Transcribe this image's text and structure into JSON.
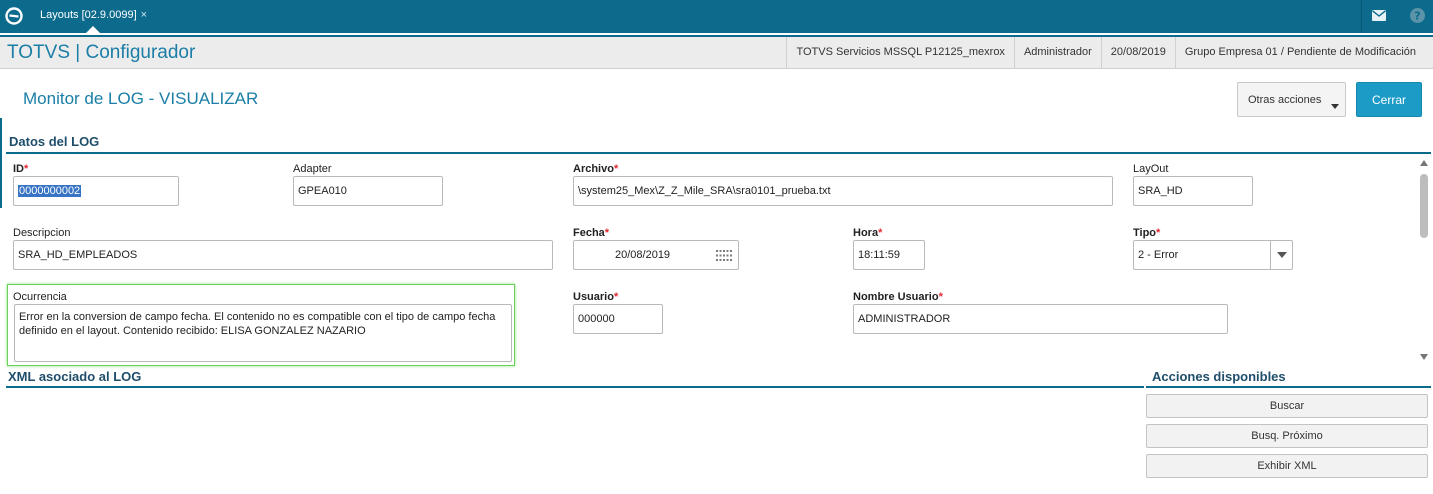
{
  "topbar": {
    "tab_label": "Layouts [02.9.0099]",
    "tab_close": "×",
    "icons": [
      "app-logo-icon",
      "mail-icon",
      "help-icon"
    ]
  },
  "header": {
    "app_title": "TOTVS | Configurador",
    "environment": "TOTVS Servicios MSSQL P12125_mexrox",
    "user": "Administrador",
    "date": "20/08/2019",
    "company": "Grupo Empresa 01 / Pendiente de Modificación"
  },
  "page": {
    "title": "Monitor de LOG - VISUALIZAR",
    "otras_acciones": "Otras acciones",
    "cerrar": "Cerrar"
  },
  "section_log": {
    "title": "Datos del LOG",
    "fields": {
      "id": {
        "label": "ID",
        "value": "0000000002"
      },
      "adapter": {
        "label": "Adapter",
        "value": "GPEA010"
      },
      "archivo": {
        "label": "Archivo",
        "value": "\\system25_Mex\\Z_Z_Mile_SRA\\sra0101_prueba.txt"
      },
      "layout": {
        "label": "LayOut",
        "value": "SRA_HD"
      },
      "descripcion": {
        "label": "Descripcion",
        "value": "SRA_HD_EMPLEADOS"
      },
      "fecha": {
        "label": "Fecha",
        "value": "20/08/2019"
      },
      "hora": {
        "label": "Hora",
        "value": "18:11:59"
      },
      "tipo": {
        "label": "Tipo",
        "value": "2 - Error"
      },
      "ocurrencia": {
        "label": "Ocurrencia",
        "value": "Error en la conversion de campo fecha. El contenido no es compatible con el tipo de campo fecha definido en el layout. Contenido recibido: ELISA  GONZALEZ NAZARIO"
      },
      "usuario": {
        "label": "Usuario",
        "value": "000000"
      },
      "nombre_usuario": {
        "label": "Nombre Usuario",
        "value": "ADMINISTRADOR"
      }
    },
    "required_mark": "*"
  },
  "section_xml": {
    "title": "XML asociado al LOG"
  },
  "section_acciones": {
    "title": "Acciones disponibles",
    "buttons": [
      "Buscar",
      "Busq. Próximo",
      "Exhibir XML"
    ]
  },
  "colors": {
    "topbar": "#0c6a8c",
    "accent_text": "#1a7ea6",
    "primary_button": "#1c9bc6",
    "required": "#e0282e",
    "focus_frame": "#6bcf5b"
  }
}
